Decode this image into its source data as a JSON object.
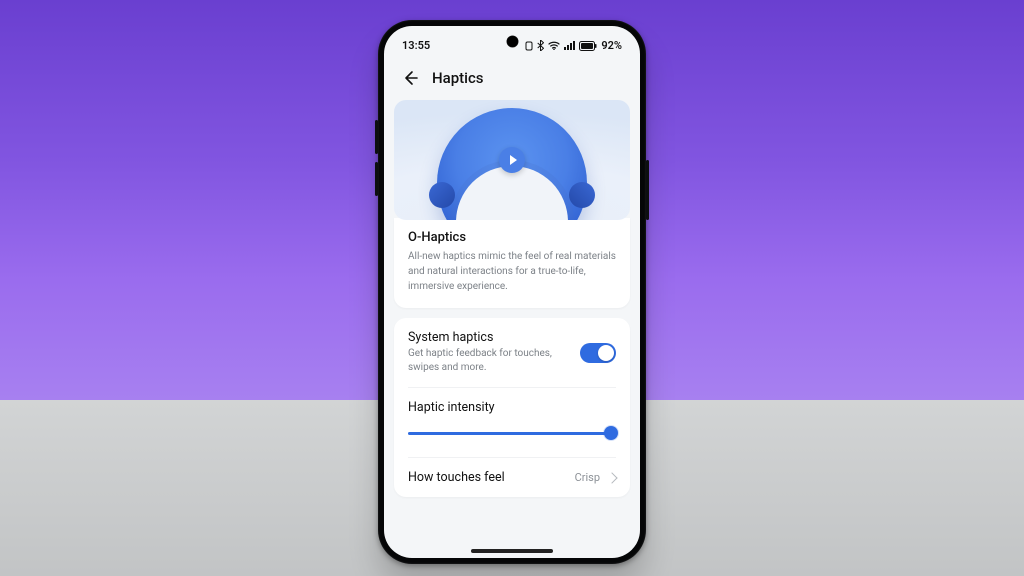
{
  "status": {
    "time": "13:55",
    "battery_pct": "92%"
  },
  "header": {
    "title": "Haptics"
  },
  "hero": {
    "icon": "play-icon"
  },
  "ohaptics": {
    "title": "O-Haptics",
    "desc": "All-new haptics mimic the feel of real materials and natural interactions for a true-to-life, immersive experience."
  },
  "settings": {
    "system_haptics": {
      "title": "System haptics",
      "desc": "Get haptic feedback for touches, swipes and more.",
      "enabled": true
    },
    "intensity": {
      "title": "Haptic intensity",
      "value": 100
    },
    "feel": {
      "title": "How touches feel",
      "value": "Crisp"
    }
  }
}
